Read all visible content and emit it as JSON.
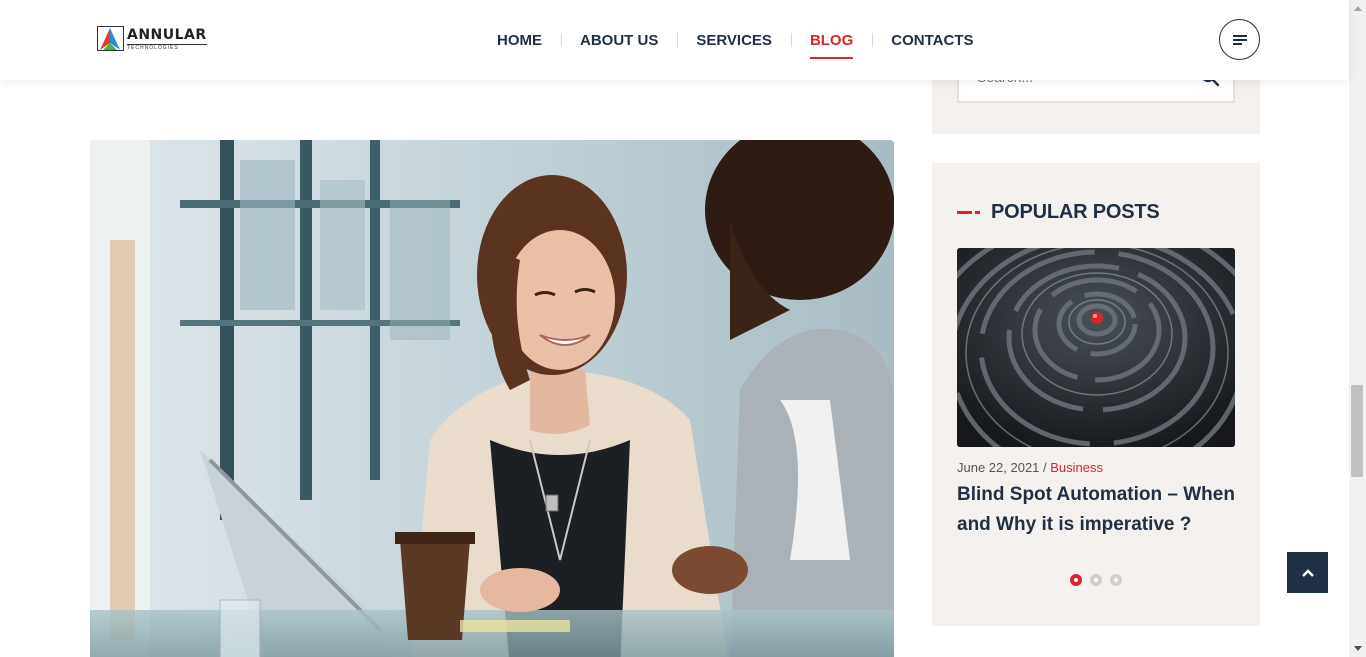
{
  "header": {
    "logo": {
      "name": "ANNULAR",
      "sub": "TECHNOLOGIES"
    },
    "nav": [
      {
        "label": "HOME",
        "active": false
      },
      {
        "label": "ABOUT US",
        "active": false
      },
      {
        "label": "SERVICES",
        "active": false
      },
      {
        "label": "BLOG",
        "active": true
      },
      {
        "label": "CONTACTS",
        "active": false
      }
    ],
    "menu_icon": "hamburger-icon"
  },
  "sidebar": {
    "search": {
      "placeholder": "Search...",
      "icon": "search-icon"
    },
    "popular_posts": {
      "title": "POPULAR POSTS",
      "post": {
        "date": "June 22, 2021",
        "separator": " / ",
        "category": "Business",
        "title": "Blind Spot Automation – When and Why it is imperative ?"
      },
      "carousel": {
        "count": 3,
        "active": 0
      }
    }
  },
  "colors": {
    "accent": "#d8262c",
    "navy": "#1f2f44",
    "sidebar_bg": "#f5f1ee"
  },
  "scroll_top_icon": "chevron-up-icon"
}
